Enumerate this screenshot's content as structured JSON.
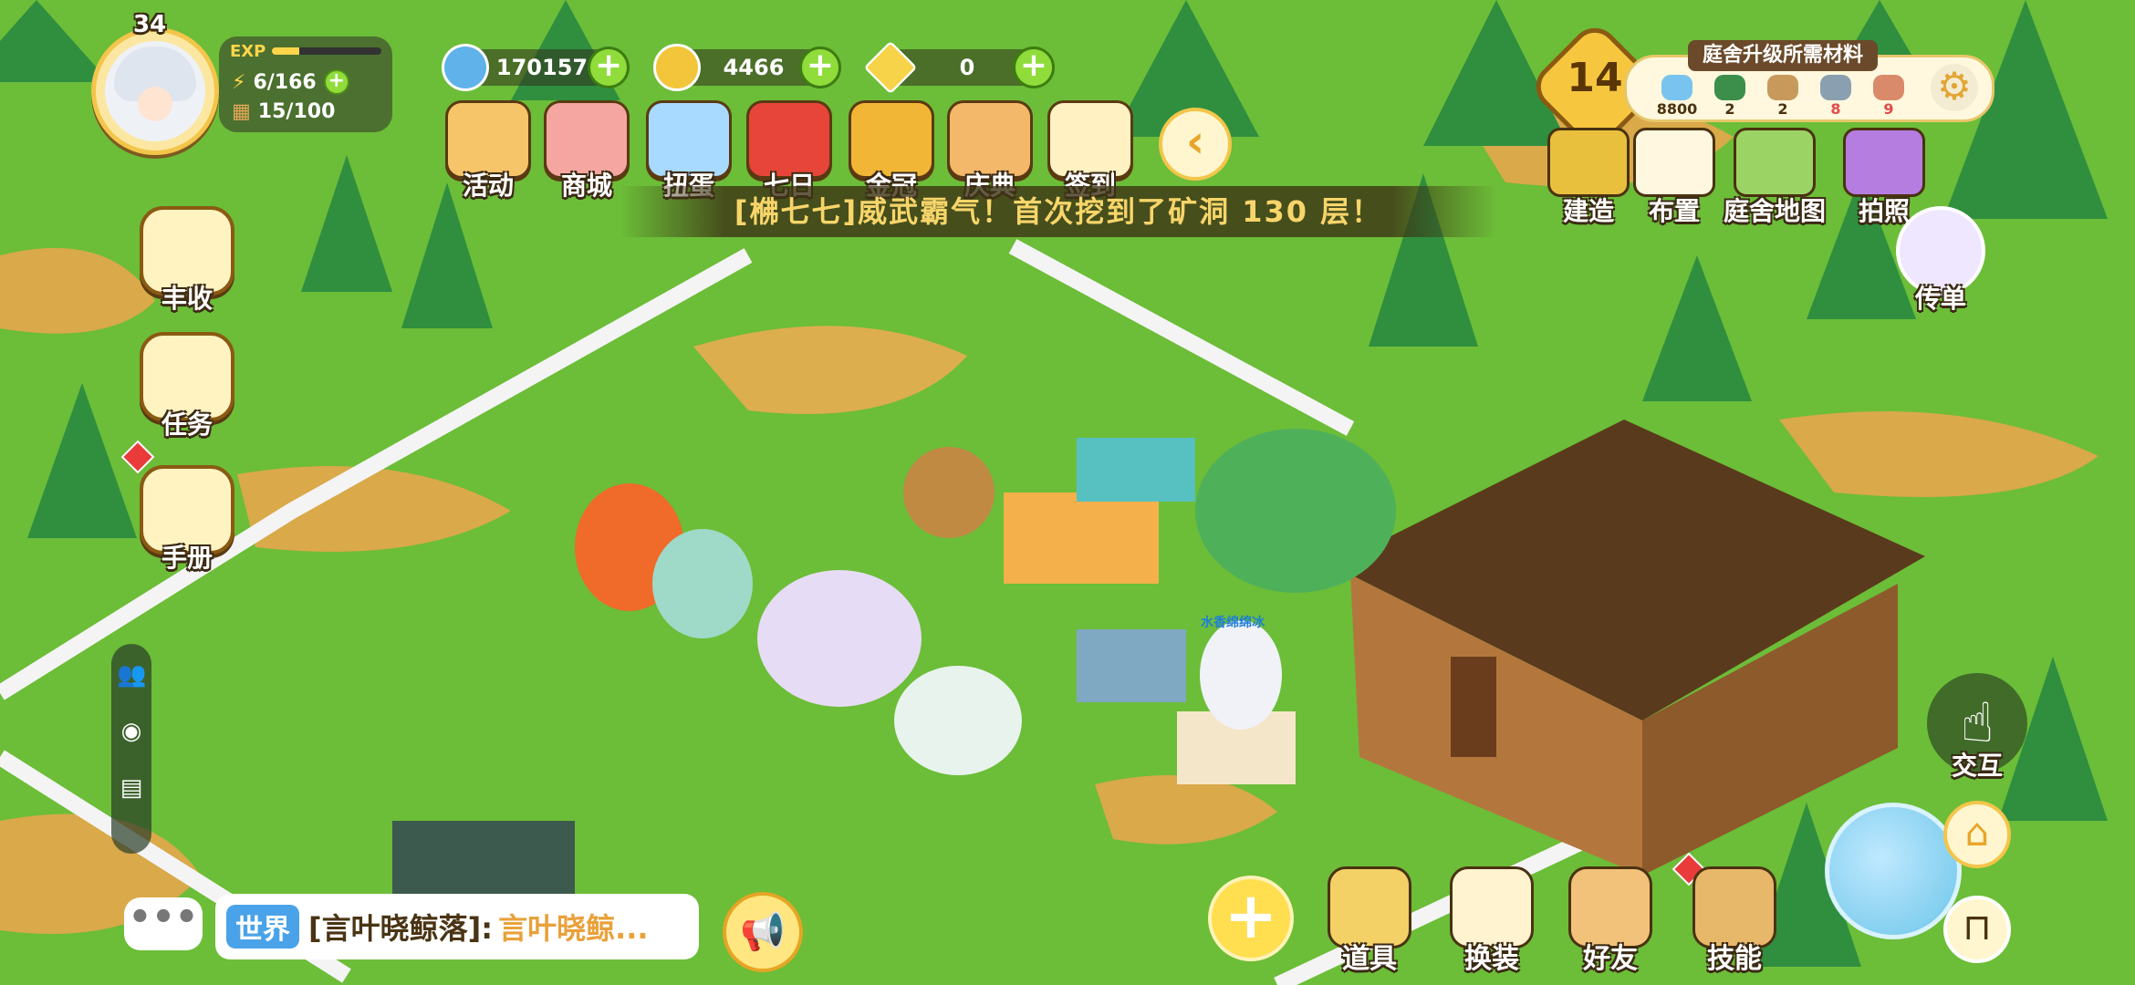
{
  "player": {
    "level": "34",
    "exp_label": "EXP",
    "exp_progress": 0.25,
    "energy": "6/166",
    "storage": "15/100"
  },
  "currencies": [
    {
      "icon": "blue-gem-coin-icon",
      "value": "170157",
      "color": "#5fb2ea"
    },
    {
      "icon": "gold-coin-icon",
      "value": "4466",
      "color": "#f2c53a"
    },
    {
      "icon": "diamond-icon",
      "value": "0",
      "color": "#f7d34a"
    }
  ],
  "top_menu": [
    {
      "icon": "bear-gift-icon",
      "label": "活动",
      "color": "#f6c56a"
    },
    {
      "icon": "shop-icon",
      "label": "商城",
      "color": "#f5a6a0"
    },
    {
      "icon": "capsule-cat-icon",
      "label": "扭蛋",
      "color": "#a8d9ff"
    },
    {
      "icon": "seven-day-badge-icon",
      "label": "七日",
      "color": "#e8453a"
    },
    {
      "icon": "gold-crown-icon",
      "label": "金冠",
      "color": "#f2b636"
    },
    {
      "icon": "celebration-bowl-icon",
      "label": "庆典",
      "color": "#f4b86a"
    },
    {
      "icon": "calendar-checkin-icon",
      "label": "签到",
      "color": "#fff1c2"
    }
  ],
  "banner_text": "[梻七七]威武霸气！首次挖到了矿洞 130 层！",
  "garden": {
    "level": "14",
    "materials_title": "庭舍升级所需材料",
    "materials": [
      {
        "icon": "blue-gem-material-icon",
        "value": "8800",
        "color": "#79c4ef",
        "text_color": "#4a3210"
      },
      {
        "icon": "leaf-material-icon",
        "value": "2",
        "color": "#3b8f4a",
        "text_color": "#4a3210"
      },
      {
        "icon": "seed-material-icon",
        "value": "2",
        "color": "#c79a5c",
        "text_color": "#4a3210"
      },
      {
        "icon": "iron-material-icon",
        "value": "8",
        "color": "#8aa0b0",
        "text_color": "#e24a4a"
      },
      {
        "icon": "plank-material-icon",
        "value": "9",
        "color": "#d98a6a",
        "text_color": "#e24a4a"
      }
    ]
  },
  "build_menu": [
    {
      "icon": "build-barrier-icon",
      "label": "建造",
      "color": "#e9c03e"
    },
    {
      "icon": "paint-roller-icon",
      "label": "布置",
      "color": "#fff7df"
    },
    {
      "icon": "garden-map-icon",
      "label": "庭舍地图",
      "color": "#9bd365"
    },
    {
      "icon": "camera-icon",
      "label": "拍照",
      "color": "#b57de0"
    }
  ],
  "left_menu": [
    {
      "icon": "harvest-icon",
      "label": "丰收"
    },
    {
      "icon": "task-trophy-icon",
      "label": "任务"
    },
    {
      "icon": "handbook-icon",
      "label": "手册"
    }
  ],
  "side_tabs": [
    "friends-tab-icon",
    "eye-tab-icon",
    "inventory-tab-icon"
  ],
  "flyer_label": "传单",
  "npc_name": "水香绵绵冰",
  "chat": {
    "channel": "世界",
    "sender": "[言叶晓鲸落]:",
    "message": "言叶晓鲸..."
  },
  "bottom_menu": [
    {
      "icon": "props-wand-icon",
      "label": "道具",
      "color": "#f3d167"
    },
    {
      "icon": "outfit-hanger-icon",
      "label": "换装",
      "color": "#fff3d0"
    },
    {
      "icon": "friend-cow-icon",
      "label": "好友",
      "color": "#f2c27a"
    },
    {
      "icon": "skill-box-icon",
      "label": "技能",
      "color": "#e7b86a"
    }
  ],
  "interact_label": "交互"
}
